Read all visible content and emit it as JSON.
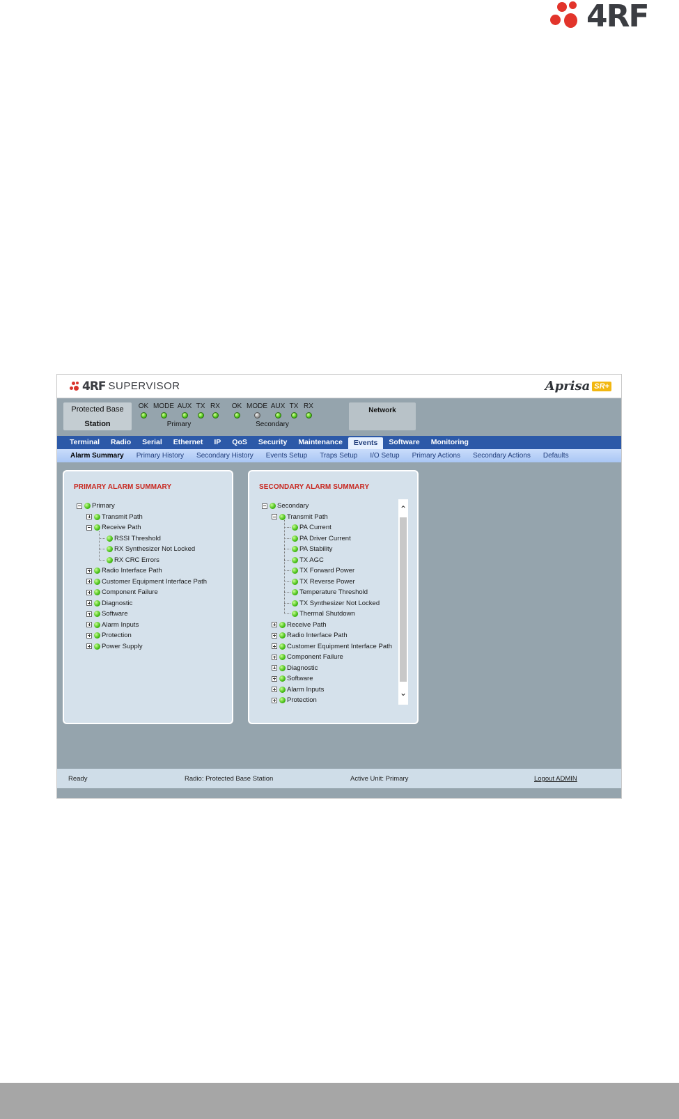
{
  "page_logo": {
    "brand": "4RF"
  },
  "app": {
    "brand": "4RF",
    "product": "SUPERVISOR",
    "aprisa": {
      "word": "Aprisa",
      "badge": "SR+"
    },
    "unit_box": {
      "line1": "Protected Base",
      "line2": "Station"
    },
    "primary_leds": {
      "labels": [
        "OK",
        "MODE",
        "AUX",
        "TX",
        "RX"
      ],
      "states": [
        "green",
        "green",
        "green",
        "green",
        "green"
      ],
      "group_name": "Primary"
    },
    "secondary_leds": {
      "labels": [
        "OK",
        "MODE",
        "AUX",
        "TX",
        "RX"
      ],
      "states": [
        "green",
        "grey",
        "green",
        "green",
        "green"
      ],
      "group_name": "Secondary"
    },
    "network_label": "Network",
    "main_nav": [
      "Terminal",
      "Radio",
      "Serial",
      "Ethernet",
      "IP",
      "QoS",
      "Security",
      "Maintenance",
      "Events",
      "Software",
      "Monitoring"
    ],
    "main_nav_active": "Events",
    "sub_nav": [
      "Alarm Summary",
      "Primary History",
      "Secondary History",
      "Events Setup",
      "Traps Setup",
      "I/O Setup",
      "Primary Actions",
      "Secondary Actions",
      "Defaults"
    ],
    "sub_nav_active": "Alarm Summary",
    "primary_panel": {
      "title": "PRIMARY ALARM SUMMARY",
      "root": "Primary",
      "items": [
        {
          "label": "Transmit Path",
          "expanded": false,
          "children": []
        },
        {
          "label": "Receive Path",
          "expanded": true,
          "children": [
            "RSSI Threshold",
            "RX Synthesizer Not Locked",
            "RX CRC Errors"
          ]
        },
        {
          "label": "Radio Interface Path",
          "expanded": false,
          "children": []
        },
        {
          "label": "Customer Equipment Interface Path",
          "expanded": false,
          "children": []
        },
        {
          "label": "Component Failure",
          "expanded": false,
          "children": []
        },
        {
          "label": "Diagnostic",
          "expanded": false,
          "children": []
        },
        {
          "label": "Software",
          "expanded": false,
          "children": []
        },
        {
          "label": "Alarm Inputs",
          "expanded": false,
          "children": []
        },
        {
          "label": "Protection",
          "expanded": false,
          "children": []
        },
        {
          "label": "Power Supply",
          "expanded": false,
          "children": []
        }
      ]
    },
    "secondary_panel": {
      "title": "SECONDARY ALARM SUMMARY",
      "root": "Secondary",
      "items": [
        {
          "label": "Transmit Path",
          "expanded": true,
          "children": [
            "PA Current",
            "PA Driver Current",
            "PA Stability",
            "TX AGC",
            "TX Forward Power",
            "TX Reverse Power",
            "Temperature Threshold",
            "TX Synthesizer Not Locked",
            "Thermal Shutdown"
          ]
        },
        {
          "label": "Receive Path",
          "expanded": false,
          "children": []
        },
        {
          "label": "Radio Interface Path",
          "expanded": false,
          "children": []
        },
        {
          "label": "Customer Equipment Interface Path",
          "expanded": false,
          "children": []
        },
        {
          "label": "Component Failure",
          "expanded": false,
          "children": []
        },
        {
          "label": "Diagnostic",
          "expanded": false,
          "children": []
        },
        {
          "label": "Software",
          "expanded": false,
          "children": []
        },
        {
          "label": "Alarm Inputs",
          "expanded": false,
          "children": []
        },
        {
          "label": "Protection",
          "expanded": false,
          "children": []
        }
      ],
      "scroll_up_icon": "chevron-up-icon",
      "scroll_down_icon": "chevron-down-icon"
    },
    "status_footer": {
      "status": "Ready",
      "radio": "Radio: Protected Base Station",
      "active_unit": "Active Unit: Primary",
      "logout": "Logout ADMIN"
    },
    "colors": {
      "nav_bg": "#2c59a8",
      "panel_title": "#c8261e",
      "app_bg": "#95a4ad",
      "led_green": "#45bd15"
    }
  }
}
